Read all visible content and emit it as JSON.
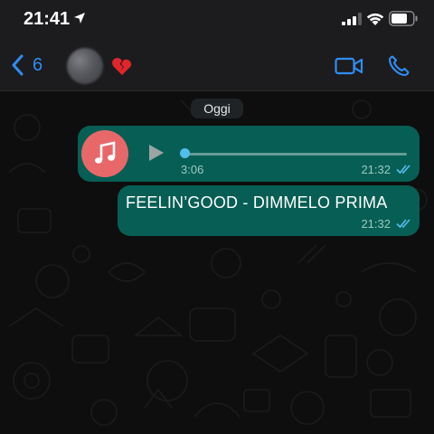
{
  "status_bar": {
    "time": "21:41"
  },
  "nav": {
    "back_count": "6",
    "status_emoji": "💔"
  },
  "chat": {
    "date_separator": "Oggi",
    "messages": [
      {
        "type": "audio",
        "duration": "3:06",
        "time": "21:32",
        "status": "read",
        "progress": 0
      },
      {
        "type": "text",
        "text": "FEELIN’GOOD - DIMMELO PRIMA",
        "time": "21:32",
        "status": "read"
      }
    ]
  },
  "colors": {
    "bubble_outgoing": "#075e54",
    "accent_blue": "#2f8df3",
    "read_ticks": "#53bdeb",
    "music_icon_bg": "#e8686a"
  },
  "icons": [
    "location-arrow-icon",
    "signal-icon",
    "wifi-icon",
    "battery-icon",
    "chevron-left-icon",
    "broken-heart-icon",
    "video-camera-icon",
    "phone-icon",
    "music-note-icon",
    "play-icon",
    "double-check-icon"
  ]
}
